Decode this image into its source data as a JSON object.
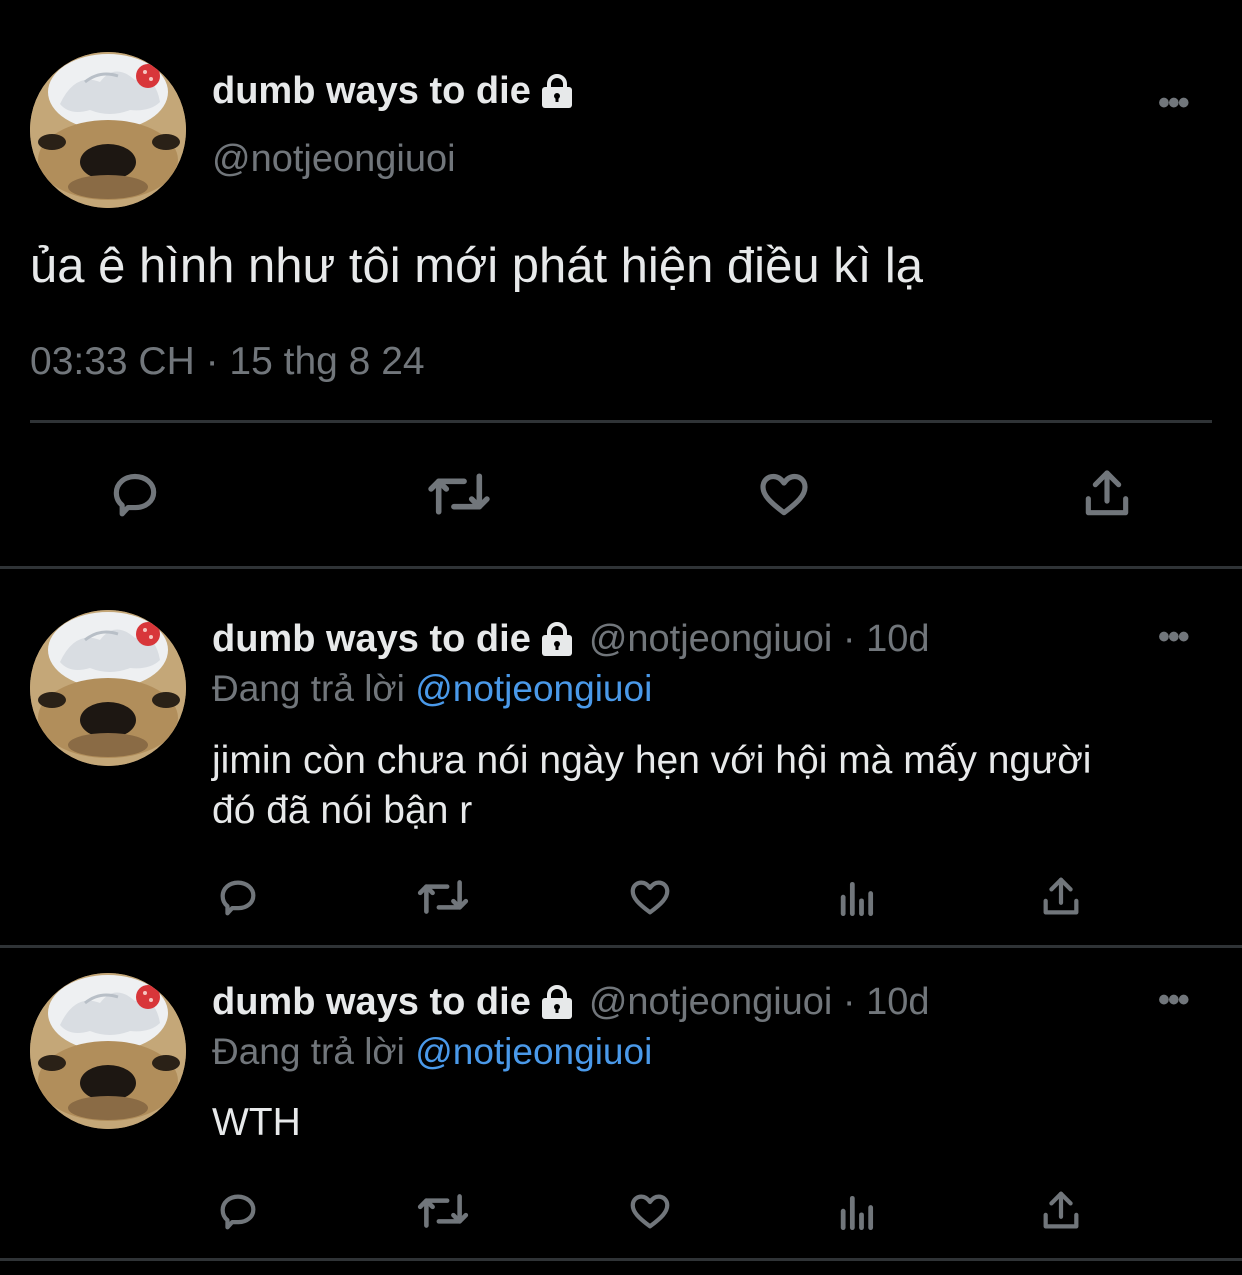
{
  "main_tweet": {
    "display_name": "dumb ways to die",
    "handle": "@notjeongiuoi",
    "text": "ủa ê hình như tôi mới phát hiện điều kì lạ",
    "timestamp": "03:33 CH · 15 thg 8 24",
    "more_label": "•••"
  },
  "replies": [
    {
      "display_name": "dumb ways to die",
      "handle_time": "@notjeongiuoi · 10d",
      "replying_label": "Đang trả lời",
      "replying_to": "@notjeongiuoi",
      "text_line1": "jimin còn chưa nói ngày hẹn với hội mà mấy người",
      "text_line2": "đó đã nói bận r",
      "more_label": "•••"
    },
    {
      "display_name": "dumb ways to die",
      "handle_time": "@notjeongiuoi · 10d",
      "replying_label": "Đang trả lời",
      "replying_to": "@notjeongiuoi",
      "text_line1": "WTH",
      "text_line2": "",
      "more_label": "•••"
    }
  ],
  "icons": {
    "reply": "reply-icon",
    "retweet": "retweet-icon",
    "like": "heart-icon",
    "views": "views-icon",
    "share": "share-icon",
    "lock": "lock-icon"
  },
  "colors": {
    "background": "#000000",
    "text": "#e7e9ea",
    "muted": "#71767b",
    "link": "#4a99e9",
    "divider": "#2f3336"
  }
}
